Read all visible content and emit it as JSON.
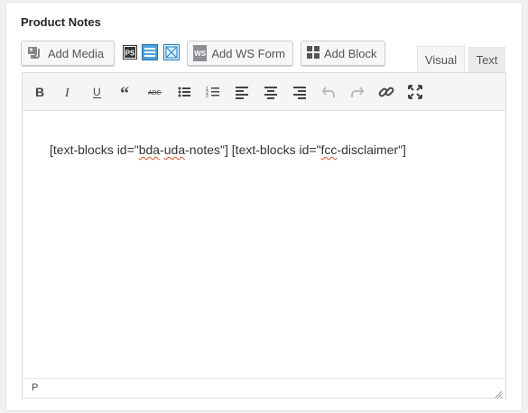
{
  "metabox": {
    "title": "Product Notes"
  },
  "media_buttons": {
    "add_media": "Add Media",
    "add_ws_form": "Add WS Form",
    "add_block": "Add Block",
    "ws_badge": "WS",
    "ps_badge": "PS"
  },
  "tabs": {
    "visual": "Visual",
    "text": "Text"
  },
  "toolbar": [
    "bold-icon",
    "italic-icon",
    "underline-icon",
    "blockquote-icon",
    "strikethrough-icon",
    "bullet-list-icon",
    "numbered-list-icon",
    "align-left-icon",
    "align-center-icon",
    "align-right-icon",
    "undo-icon",
    "redo-icon",
    "link-icon",
    "fullscreen-icon"
  ],
  "content": {
    "p1": "[text-blocks id=\"",
    "w1": "bda",
    "p2": "-",
    "w2": "uda",
    "p3": "-notes\"] [text-blocks id=\"",
    "w3": "fcc",
    "p4": "-disclaimer\"]"
  },
  "statusbar": {
    "path": "P"
  },
  "colors": {
    "accent": "#0073aa",
    "spellcheck": "#d54e21"
  }
}
